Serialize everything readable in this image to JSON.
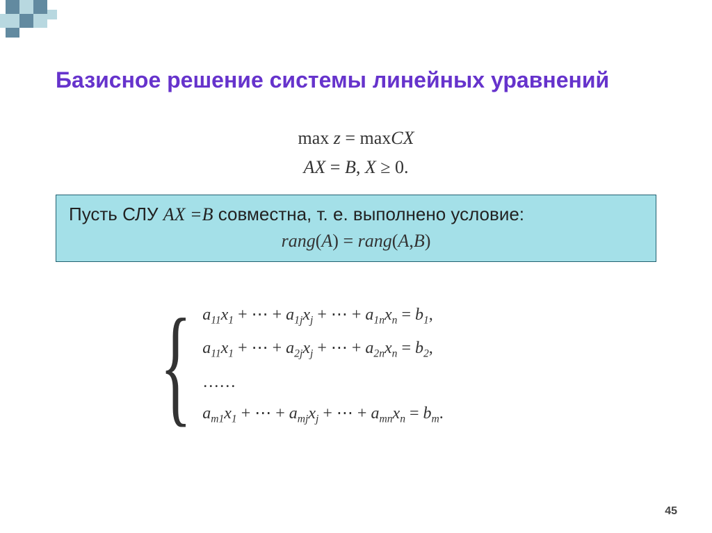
{
  "title": "Базисное решение системы линейных уравнений",
  "objective": {
    "line1_html": "max <i>z</i> = max <i>CX</i>",
    "line2_html": "<i>AX</i> = <i>B</i>, <i>X</i> ≥ 0."
  },
  "box": {
    "text_prefix": "Пусть СЛУ  ",
    "text_axb": "AX =B",
    "text_suffix": "  совместна, т. е. выполнено условие:",
    "equation": "rang(A) = rang(A,B)"
  },
  "system": {
    "rows": [
      "a₁₁x₁ + ⋯ + a₁ⱼxⱼ + ⋯ + a₁ₙxₙ = b₁,",
      "a₁₁x₁ + ⋯ + a₂ⱼxⱼ + ⋯ + a₂ₙxₙ = b₂,",
      "……",
      "aₘ₁x₁ + ⋯ + aₘⱼxⱼ + ⋯ + aₘₙxₙ = bₘ."
    ]
  },
  "page_number": "45",
  "deco_colors": {
    "dark": "#628aa0",
    "light": "#b8d8e0"
  }
}
